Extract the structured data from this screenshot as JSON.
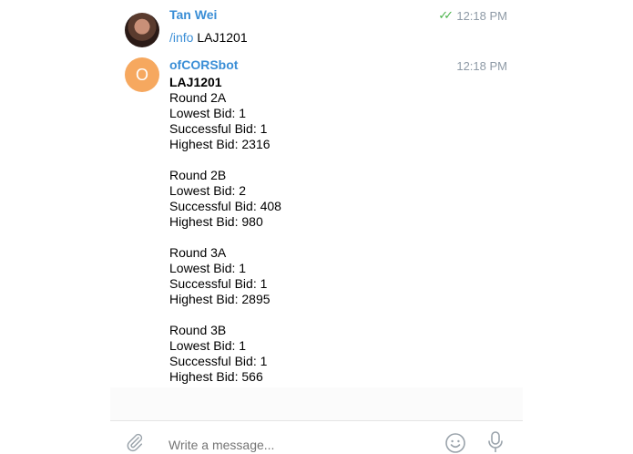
{
  "messages": [
    {
      "sender": "Tan Wei",
      "time": "12:18 PM",
      "read_checks": "✓✓",
      "command": "/info",
      "argument": "LAJ1201"
    },
    {
      "sender": "ofCORSbot",
      "avatar_letter": "O",
      "time": "12:18 PM",
      "title": "LAJ1201",
      "rounds": [
        {
          "round": "Round 2A",
          "lowest": "Lowest Bid: 1",
          "successful": "Successful Bid: 1",
          "highest": "Highest Bid: 2316"
        },
        {
          "round": "Round 2B",
          "lowest": "Lowest Bid: 2",
          "successful": "Successful Bid: 408",
          "highest": "Highest Bid: 980"
        },
        {
          "round": "Round 3A",
          "lowest": "Lowest Bid: 1",
          "successful": "Successful Bid: 1",
          "highest": "Highest Bid: 2895"
        },
        {
          "round": "Round 3B",
          "lowest": "Lowest Bid: 1",
          "successful": "Successful Bid: 1",
          "highest": "Highest Bid: 566"
        }
      ]
    }
  ],
  "composer": {
    "placeholder": "Write a message..."
  },
  "icons": {
    "attach": "paperclip-icon",
    "emoji": "emoji-icon",
    "mic": "microphone-icon"
  },
  "colors": {
    "link": "#3a8ed6",
    "avatar_bot": "#f6a85f",
    "read_check": "#4cb44c"
  }
}
